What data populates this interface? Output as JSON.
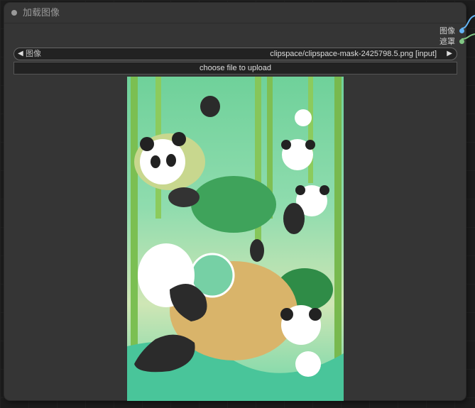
{
  "node": {
    "title": "加载图像",
    "outputs": [
      {
        "label": "图像",
        "color": "#64b5f6"
      },
      {
        "label": "遮罩",
        "color": "#81c784"
      }
    ]
  },
  "image_widget": {
    "label": "图像",
    "value": "clipspace/clipspace-mask-2425798.5.png [input]",
    "left_arrow": "◀",
    "right_arrow": "▶"
  },
  "upload_button": {
    "label": "choose file to upload"
  },
  "icons": {
    "collapse": "circle-dot",
    "prev": "triangle-left",
    "next": "triangle-right"
  },
  "preview_image": {
    "alt": "Cartoon pandas in a bamboo forest with a masked region"
  }
}
